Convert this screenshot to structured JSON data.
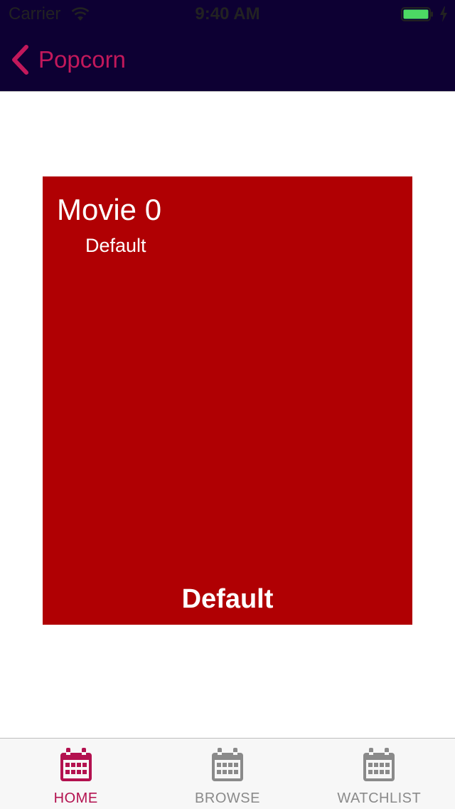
{
  "status_bar": {
    "carrier": "Carrier",
    "time": "9:40 AM",
    "icons": [
      "wifi-icon",
      "battery-icon",
      "charging-bolt-icon"
    ],
    "battery_color": "#4cd964"
  },
  "nav": {
    "back_label": "Popcorn",
    "back_icon": "chevron-left-icon",
    "background": "#0d0033",
    "accent": "#c2185b"
  },
  "card": {
    "title": "Movie 0",
    "subtitle": "Default",
    "footer": "Default",
    "background": "#b00003"
  },
  "tabs": [
    {
      "label": "HOME",
      "icon": "calendar-icon",
      "active": true
    },
    {
      "label": "BROWSE",
      "icon": "calendar-icon",
      "active": false
    },
    {
      "label": "WATCHLIST",
      "icon": "calendar-icon",
      "active": false
    }
  ],
  "colors": {
    "tab_active": "#b3114f",
    "tab_inactive": "#8a8a8a"
  }
}
